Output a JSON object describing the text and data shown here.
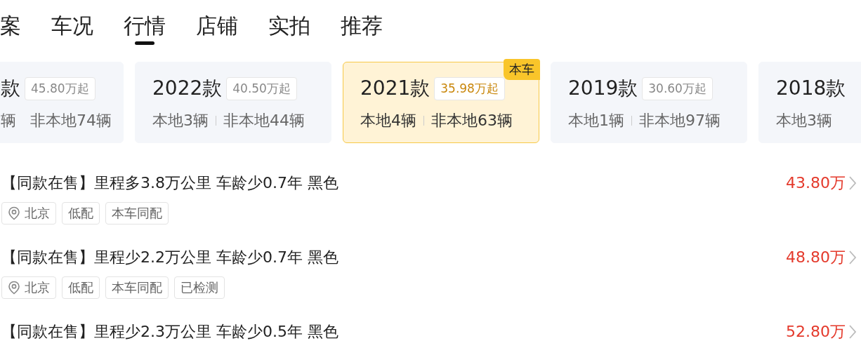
{
  "tabs": [
    {
      "label": "案",
      "selected": false
    },
    {
      "label": "车况",
      "selected": false
    },
    {
      "label": "行情",
      "selected": true
    },
    {
      "label": "店铺",
      "selected": false
    },
    {
      "label": "实拍",
      "selected": false
    },
    {
      "label": "推荐",
      "selected": false
    }
  ],
  "models": [
    {
      "year": "款",
      "price": "45.80万起",
      "local": "辆",
      "nonlocal": "非本地74辆",
      "selected": false
    },
    {
      "year": "2022款",
      "price": "40.50万起",
      "local": "本地3辆",
      "nonlocal": "非本地44辆",
      "selected": false
    },
    {
      "year": "2021款",
      "price": "35.98万起",
      "local": "本地4辆",
      "nonlocal": "非本地63辆",
      "selected": true,
      "badge": "本车"
    },
    {
      "year": "2019款",
      "price": "30.60万起",
      "local": "本地1辆",
      "nonlocal": "非本地97辆",
      "selected": false
    },
    {
      "year": "2018款",
      "local": "本地3辆",
      "selected": false
    }
  ],
  "listings": [
    {
      "title": "【同款在售】里程多3.8万公里 车龄少0.7年 黑色",
      "price": "43.80万",
      "tags": [
        {
          "kind": "location",
          "label": "北京"
        },
        {
          "kind": "plain",
          "label": "低配"
        },
        {
          "kind": "plain",
          "label": "本车同配"
        }
      ]
    },
    {
      "title": "【同款在售】里程少2.2万公里 车龄少0.7年 黑色",
      "price": "48.80万",
      "tags": [
        {
          "kind": "location",
          "label": "北京"
        },
        {
          "kind": "plain",
          "label": "低配"
        },
        {
          "kind": "plain",
          "label": "本车同配"
        },
        {
          "kind": "plain",
          "label": "已检测"
        }
      ]
    },
    {
      "title": "【同款在售】里程少2.3万公里 车龄少0.5年 黑色",
      "price": "52.80万"
    }
  ]
}
